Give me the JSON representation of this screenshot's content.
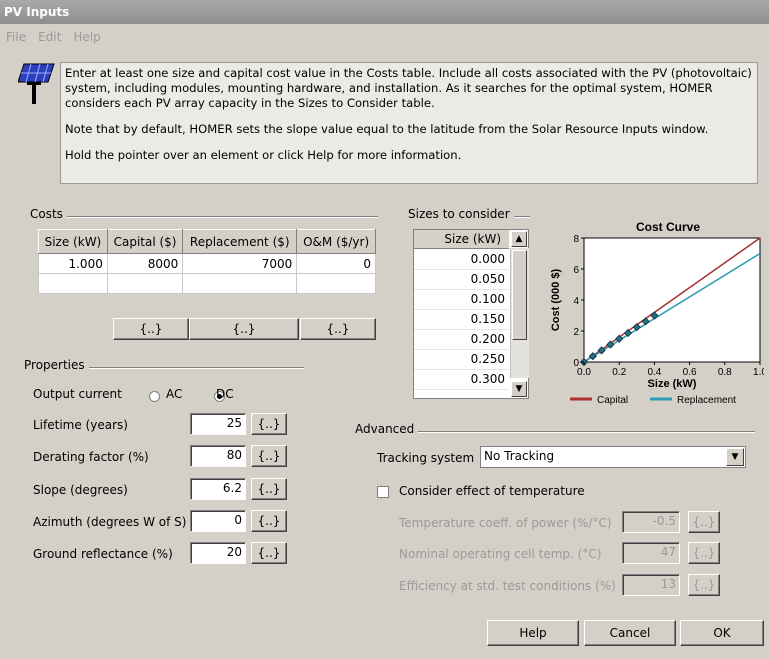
{
  "window": {
    "title": "PV Inputs"
  },
  "menu": [
    "File",
    "Edit",
    "Help"
  ],
  "info": {
    "paragraphs": [
      "Enter at least one size and capital cost value in the Costs table.  Include all costs associated with the PV (photovoltaic) system, including modules, mounting hardware, and installation. As it searches for the optimal system, HOMER considers each PV array capacity in the Sizes to Consider table.",
      "Note that by default, HOMER sets the slope value equal to the latitude from the Solar Resource Inputs window.",
      "Hold the pointer over an element or click Help for more information."
    ]
  },
  "costs": {
    "label": "Costs",
    "columns": [
      "Size (kW)",
      "Capital ($)",
      "Replacement ($)",
      "O&M ($/yr)"
    ],
    "rows": [
      [
        "1.000",
        "8000",
        "7000",
        "0"
      ]
    ],
    "button_label": "{..}"
  },
  "sizes": {
    "label": "Sizes to consider",
    "header": "Size (kW)",
    "values": [
      "0.000",
      "0.050",
      "0.100",
      "0.150",
      "0.200",
      "0.250",
      "0.300"
    ]
  },
  "chart_data": {
    "type": "line",
    "title": "Cost Curve",
    "xlabel": "Size (kW)",
    "ylabel": "Cost (000 $)",
    "xlim": [
      0,
      1
    ],
    "ylim": [
      0,
      8
    ],
    "x_ticks": [
      "0.0",
      "0.2",
      "0.4",
      "0.6",
      "0.8",
      "1.0"
    ],
    "y_ticks": [
      "0",
      "2",
      "4",
      "6",
      "8"
    ],
    "series": [
      {
        "name": "Capital",
        "color": "#a83232",
        "x": [
          0,
          1
        ],
        "y": [
          0,
          8
        ]
      },
      {
        "name": "Replacement",
        "color": "#2a9db0",
        "x": [
          0,
          1
        ],
        "y": [
          0,
          7
        ]
      }
    ],
    "markers": {
      "x": [
        0,
        0.05,
        0.1,
        0.15,
        0.2,
        0.25,
        0.3,
        0.35,
        0.4
      ]
    }
  },
  "properties": {
    "label": "Properties",
    "output_current": {
      "label": "Output current",
      "options": [
        "AC",
        "DC"
      ],
      "selected": "DC"
    },
    "fields": [
      {
        "label": "Lifetime (years)",
        "value": "25"
      },
      {
        "label": "Derating factor (%)",
        "value": "80"
      },
      {
        "label": "Slope (degrees)",
        "value": "6.2"
      },
      {
        "label": "Azimuth (degrees W of S)",
        "value": "0"
      },
      {
        "label": "Ground reflectance (%)",
        "value": "20"
      }
    ],
    "button_label": "{..}"
  },
  "advanced": {
    "label": "Advanced",
    "tracking_label": "Tracking system",
    "tracking_value": "No Tracking",
    "temperature_checkbox": "Consider effect of temperature",
    "fields": [
      {
        "label": "Temperature coeff. of power (%/°C)",
        "value": "-0.5"
      },
      {
        "label": "Nominal operating cell temp. (°C)",
        "value": "47"
      },
      {
        "label": "Efficiency at std. test conditions (%)",
        "value": "13"
      }
    ],
    "button_label": "{..}"
  },
  "buttons": {
    "help": "Help",
    "cancel": "Cancel",
    "ok": "OK"
  },
  "icons": {
    "app_icon": "solar-panel-icon"
  }
}
